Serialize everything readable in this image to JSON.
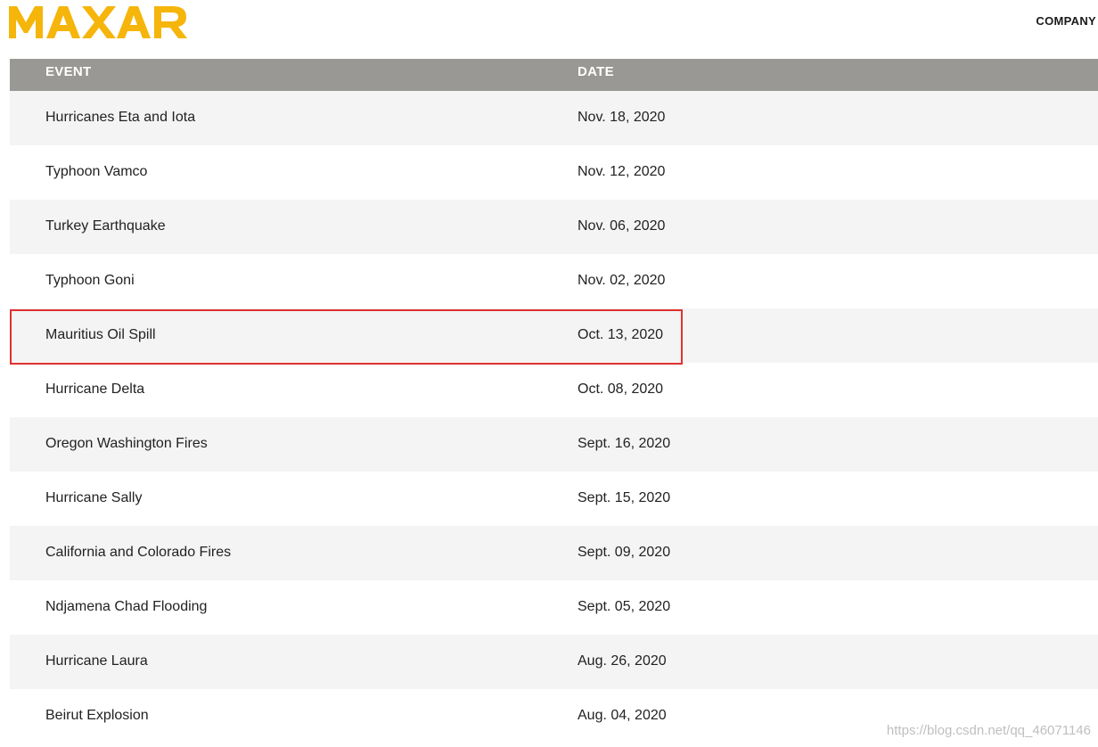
{
  "brand": {
    "logo_text": "MAXAR",
    "logo_color": "#f5b50a"
  },
  "nav": {
    "company_label": "COMPANY"
  },
  "table": {
    "headers": {
      "event": "EVENT",
      "date": "DATE"
    },
    "rows": [
      {
        "event": "Hurricanes Eta and Iota",
        "date": "Nov. 18, 2020"
      },
      {
        "event": "Typhoon Vamco",
        "date": "Nov. 12, 2020"
      },
      {
        "event": "Turkey Earthquake",
        "date": "Nov. 06, 2020"
      },
      {
        "event": "Typhoon Goni",
        "date": "Nov. 02, 2020"
      },
      {
        "event": "Mauritius Oil Spill",
        "date": "Oct. 13, 2020"
      },
      {
        "event": "Hurricane Delta",
        "date": "Oct. 08, 2020"
      },
      {
        "event": "Oregon Washington Fires",
        "date": "Sept. 16, 2020"
      },
      {
        "event": "Hurricane Sally",
        "date": "Sept. 15, 2020"
      },
      {
        "event": "California and Colorado Fires",
        "date": "Sept. 09, 2020"
      },
      {
        "event": "Ndjamena Chad Flooding",
        "date": "Sept. 05, 2020"
      },
      {
        "event": "Hurricane Laura",
        "date": "Aug. 26, 2020"
      },
      {
        "event": "Beirut Explosion",
        "date": "Aug. 04, 2020"
      }
    ],
    "header_color": "#999894",
    "highlight_color": "#e0312f"
  },
  "watermark": "https://blog.csdn.net/qq_46071146"
}
